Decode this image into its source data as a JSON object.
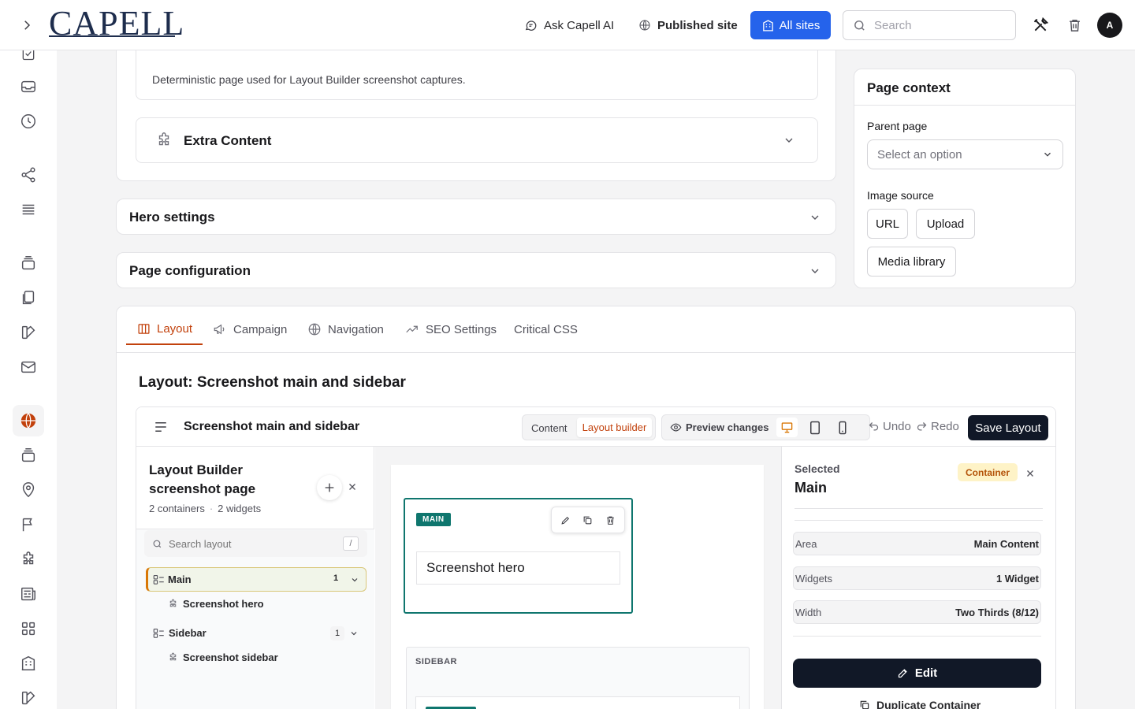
{
  "header": {
    "logo": "CAPELL",
    "ask_ai": "Ask Capell AI",
    "published_site": "Published site",
    "all_sites": "All sites",
    "search_placeholder": "Search",
    "avatar": "A"
  },
  "content": {
    "description": "Deterministic page used for Layout Builder screenshot captures.",
    "extra_content": "Extra Content",
    "hero_settings": "Hero settings",
    "page_configuration": "Page configuration"
  },
  "page_context": {
    "title": "Page context",
    "parent_page_label": "Parent page",
    "parent_page_placeholder": "Select an option",
    "image_source_label": "Image source",
    "url_button": "URL",
    "upload_button": "Upload",
    "media_library_button": "Media library"
  },
  "tabs": [
    {
      "label": "Layout"
    },
    {
      "label": "Campaign"
    },
    {
      "label": "Navigation"
    },
    {
      "label": "SEO Settings"
    },
    {
      "label": "Critical CSS"
    }
  ],
  "layout": {
    "heading": "Layout: Screenshot main and sidebar",
    "toolbar": {
      "title": "Screenshot main and sidebar",
      "content_mode": "Content",
      "builder_mode": "Layout builder",
      "preview": "Preview changes",
      "undo": "Undo",
      "redo": "Redo",
      "save": "Save Layout"
    },
    "tree": {
      "title_line1": "Layout Builder",
      "title_line2": "screenshot page",
      "containers": "2 containers",
      "separator": "·",
      "widgets": "2 widgets",
      "search_placeholder": "Search layout",
      "shortcut": "/",
      "items": [
        {
          "label": "Main",
          "count": "1",
          "child": "Screenshot hero"
        },
        {
          "label": "Sidebar",
          "count": "1",
          "child": "Screenshot sidebar"
        }
      ]
    },
    "canvas": {
      "main_tag": "MAIN",
      "hero_label": "Screenshot hero",
      "sidebar_tag": "SIDEBAR"
    },
    "inspector": {
      "selected_label": "Selected",
      "selected_name": "Main",
      "type_badge": "Container",
      "rows": [
        {
          "k": "Area",
          "v": "Main Content"
        },
        {
          "k": "Widgets",
          "v": "1 Widget"
        },
        {
          "k": "Width",
          "v": "Two Thirds (8/12)"
        }
      ],
      "edit": "Edit",
      "duplicate": "Duplicate Container"
    }
  },
  "colors": {
    "accent": "#c2410c",
    "primary": "#2563eb",
    "main_outline": "#0f766e"
  }
}
